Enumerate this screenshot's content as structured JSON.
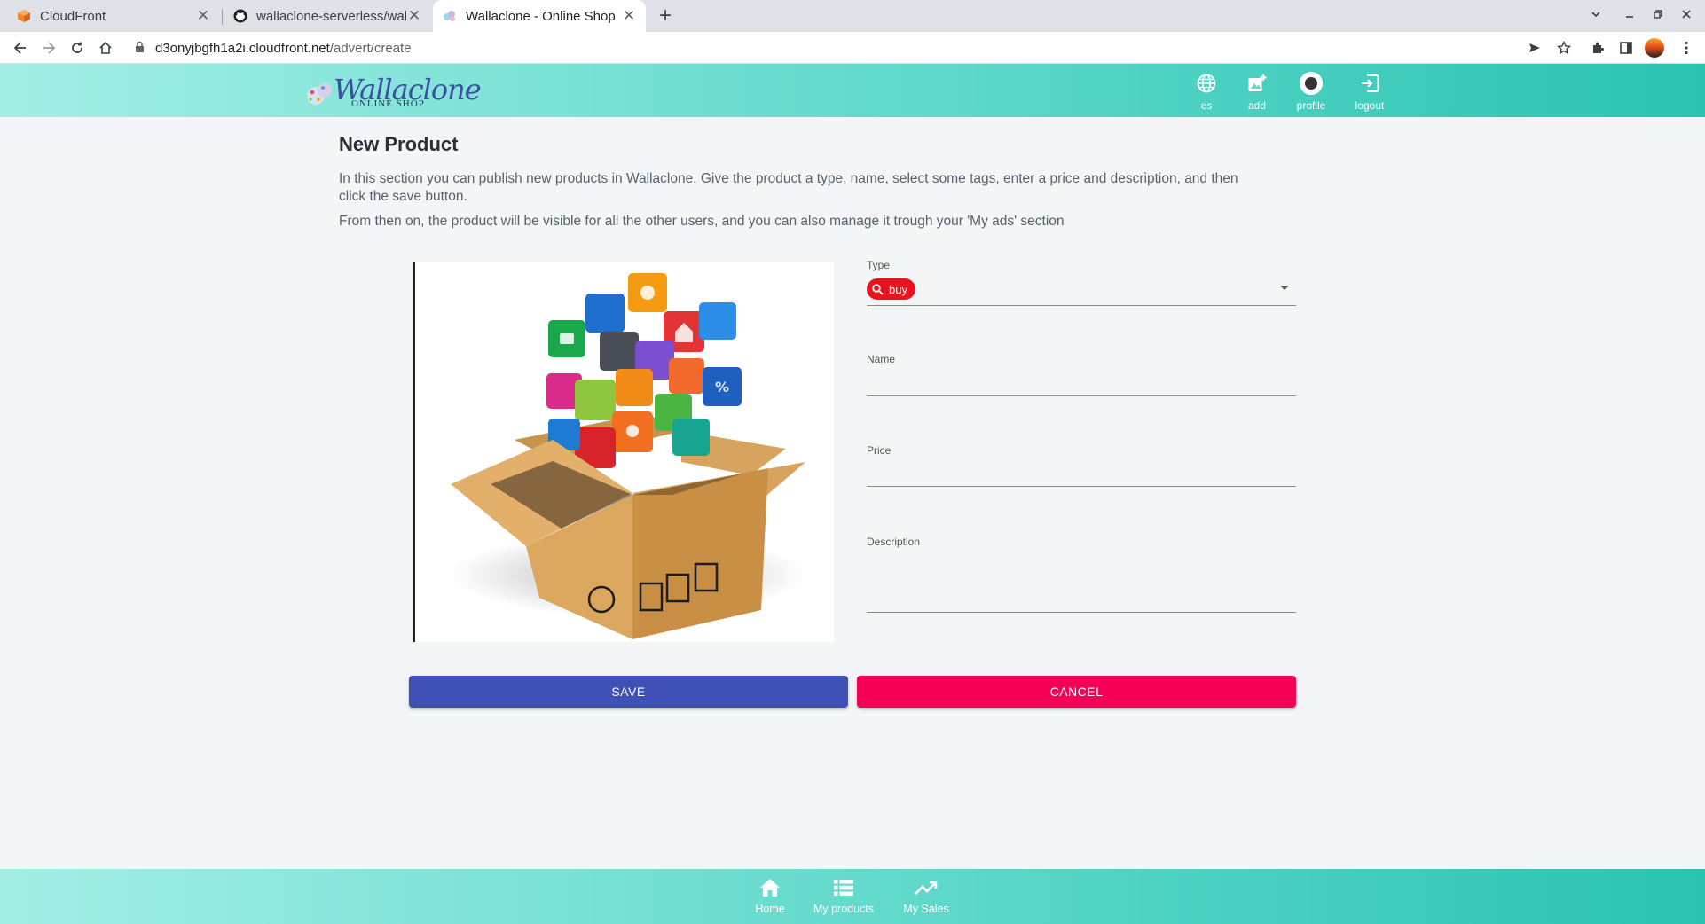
{
  "browser": {
    "tabs": [
      {
        "title": "CloudFront",
        "icon": "aws-cube-icon",
        "active": false
      },
      {
        "title": "wallaclone-serverless/wallaclone",
        "icon": "github-icon",
        "active": false
      },
      {
        "title": "Wallaclone - Online Shop",
        "icon": "wallaclone-favicon",
        "active": true
      }
    ],
    "new_tab": "+",
    "url_host": "d3onyjbgfh1a2i.cloudfront.net",
    "url_path": "/advert/create"
  },
  "header": {
    "logo_text": "Wallaclone",
    "logo_sub": "ONLINE SHOP",
    "actions": [
      {
        "label": "es",
        "icon": "globe-icon"
      },
      {
        "label": "add",
        "icon": "add-photo-icon"
      },
      {
        "label": "profile",
        "icon": "avatar-icon"
      },
      {
        "label": "logout",
        "icon": "logout-icon"
      }
    ]
  },
  "page": {
    "title": "New Product",
    "intro_1": "In this section you can publish new products in Wallaclone. Give the product a type, name, select some tags, enter a price and description, and then click the save button.",
    "intro_2": "From then on, the product will be visible for all the other users, and you can also manage it trough your 'My ads' section"
  },
  "form": {
    "type_label": "Type",
    "type_value": "buy",
    "type_icon": "search-icon",
    "name_label": "Name",
    "name_value": "",
    "price_label": "Price",
    "price_value": "",
    "description_label": "Description",
    "description_value": "",
    "image": "open cardboard box with app icon cubes"
  },
  "buttons": {
    "save": "SAVE",
    "cancel": "CANCEL"
  },
  "bottom_nav": [
    {
      "label": "Home",
      "icon": "home-icon"
    },
    {
      "label": "My products",
      "icon": "list-icon"
    },
    {
      "label": "My Sales",
      "icon": "trending-up-icon"
    }
  ],
  "colors": {
    "header_gradient_start": "#a3eee5",
    "header_gradient_end": "#2bc3b0",
    "save": "#3f51b5",
    "cancel": "#f50057",
    "chip": "#e8141d"
  }
}
